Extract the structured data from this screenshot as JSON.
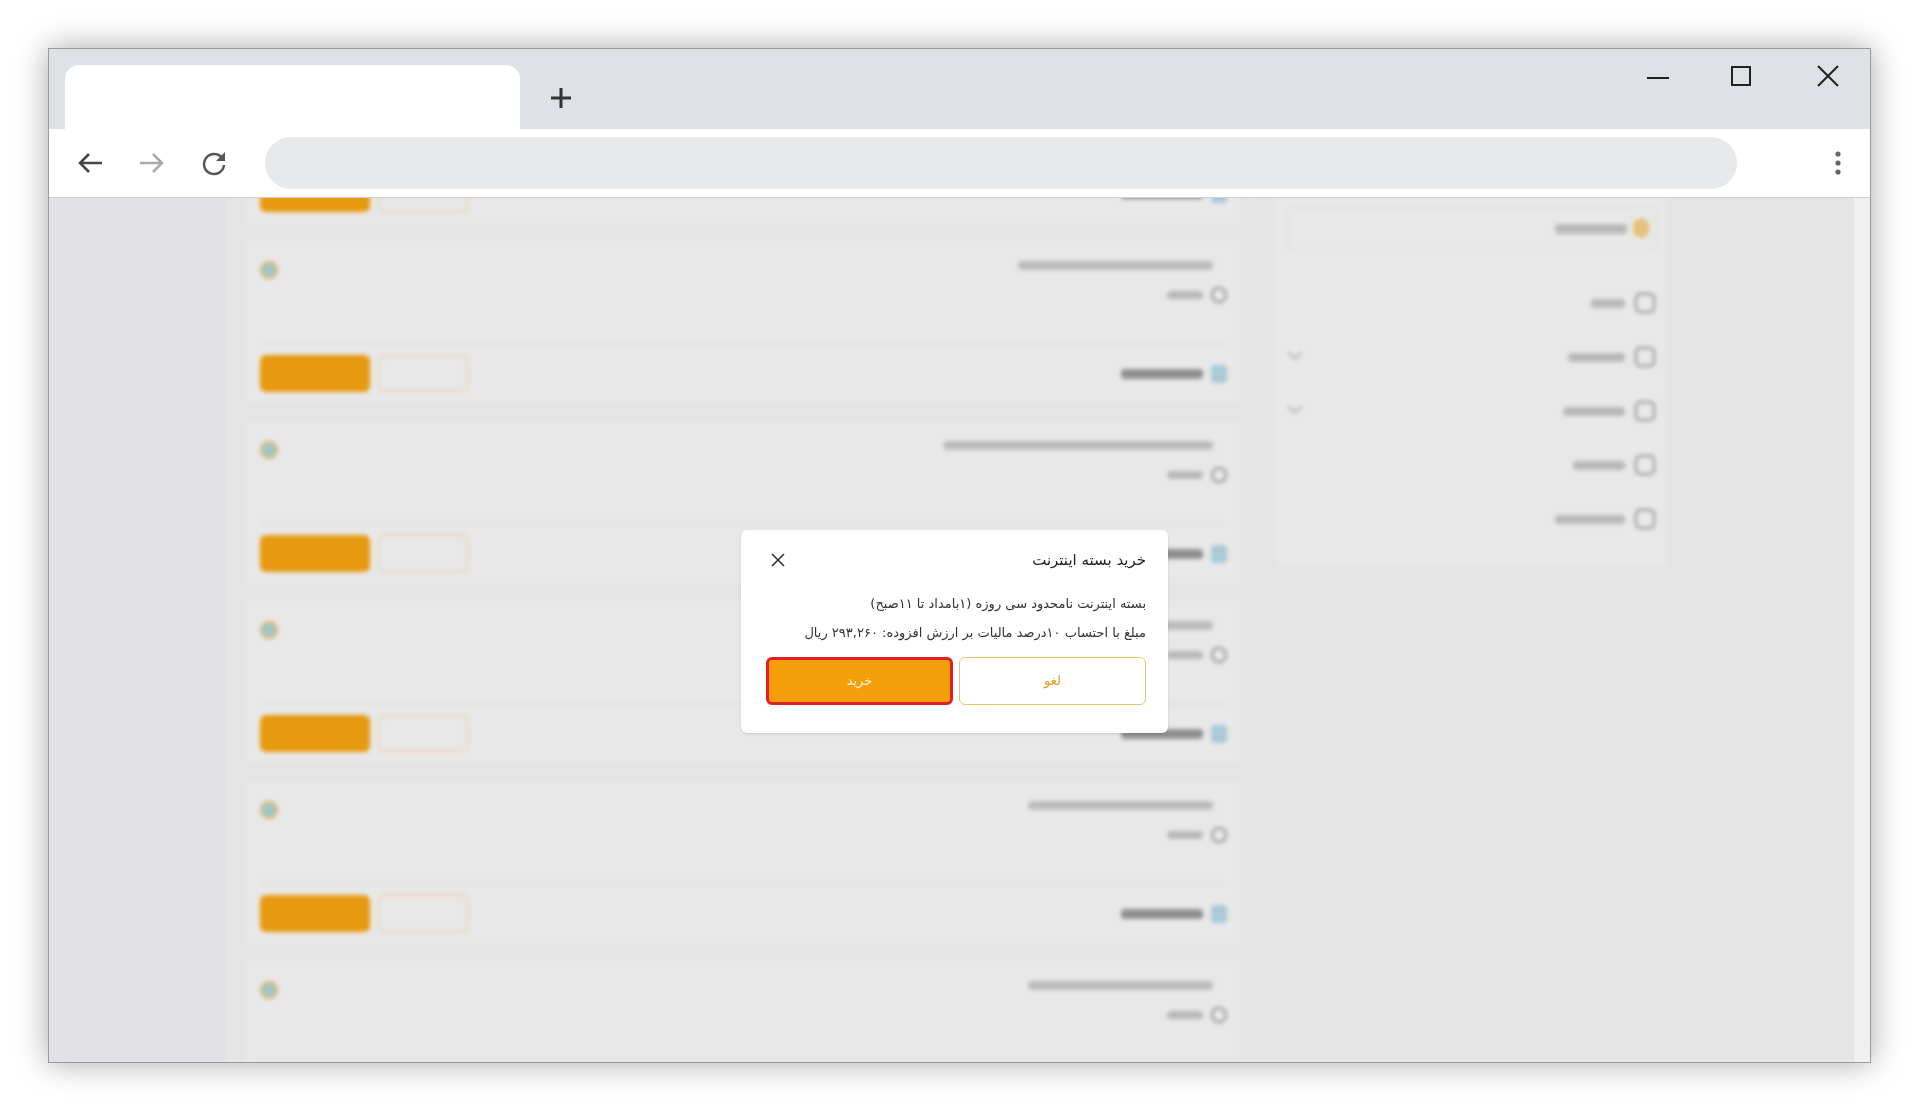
{
  "dialog": {
    "title": "خرید بسته اینترنت",
    "lines": [
      "بسته اینترنت نامحدود سی روزه (۱بامداد تا ۱۱صبح)",
      "مبلغ با احتساب ۱۰درصد مالیات بر ارزش افزوده: ۲۹۳,۲۶۰ ریال"
    ],
    "buttons": [
      {
        "label": "لغو",
        "kind": "secondary",
        "highlighted": false
      },
      {
        "label": "خرید",
        "kind": "primary",
        "highlighted": true
      }
    ]
  }
}
